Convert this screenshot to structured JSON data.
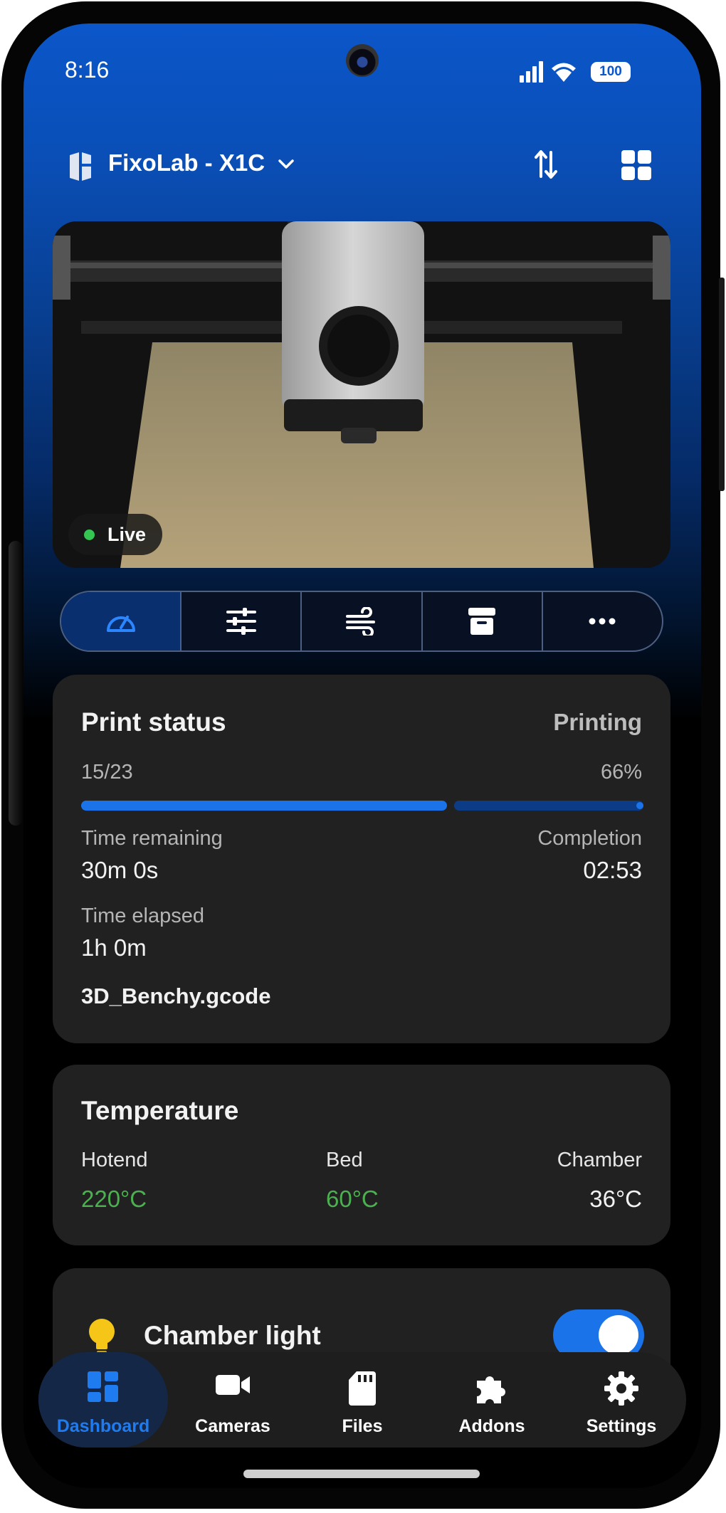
{
  "status_bar": {
    "time": "8:16",
    "battery": "100"
  },
  "header": {
    "printer_name": "FixoLab - X1C"
  },
  "camera": {
    "live_label": "Live"
  },
  "print_status": {
    "title": "Print status",
    "state": "Printing",
    "layer": "15/23",
    "percent": "66%",
    "progress": 0.66,
    "time_remaining_label": "Time remaining",
    "time_remaining": "30m 0s",
    "completion_label": "Completion",
    "completion": "02:53",
    "time_elapsed_label": "Time elapsed",
    "time_elapsed": "1h 0m",
    "file_name": "3D_Benchy.gcode"
  },
  "temperature": {
    "title": "Temperature",
    "hotend_label": "Hotend",
    "hotend": "220°C",
    "bed_label": "Bed",
    "bed": "60°C",
    "chamber_label": "Chamber",
    "chamber": "36°C"
  },
  "chamber_light": {
    "label": "Chamber light",
    "on": true
  },
  "nav": {
    "dashboard": "Dashboard",
    "cameras": "Cameras",
    "files": "Files",
    "addons": "Addons",
    "settings": "Settings"
  },
  "colors": {
    "accent": "#1a73e8",
    "ok_green": "#4caf50",
    "card_bg": "#212121"
  }
}
